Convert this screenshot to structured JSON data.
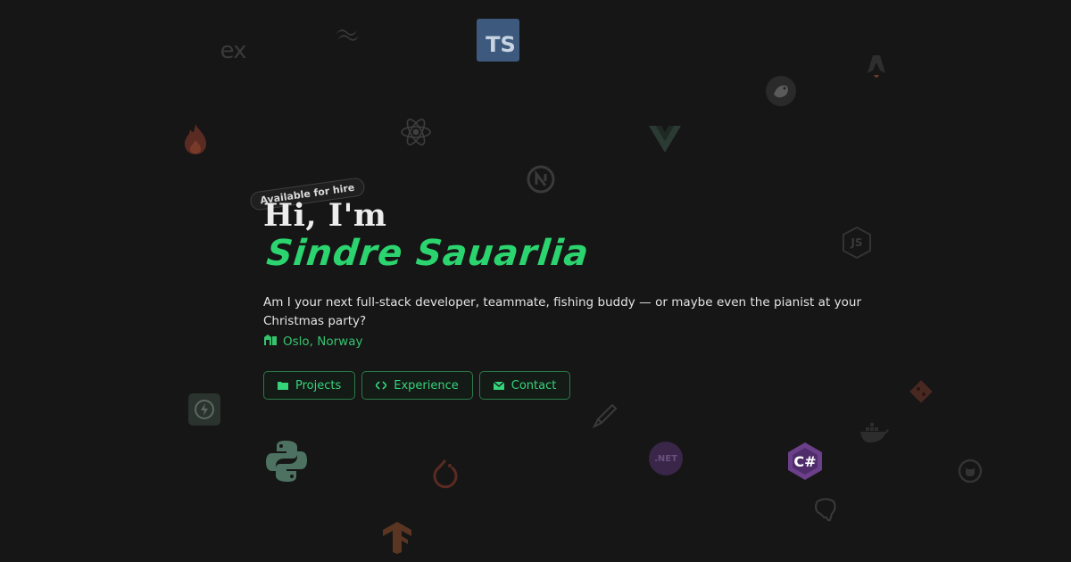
{
  "badge": "Available for hire",
  "greeting": "Hi, I'm",
  "name": "Sindre Sauarlia",
  "intro": "Am I your next full-stack developer, teammate, fishing buddy — or maybe even the pianist at your Christmas party?",
  "location": "Oslo, Norway",
  "buttons": {
    "projects": "Projects",
    "experience": "Experience",
    "contact": "Contact"
  },
  "icons": {
    "express": "ex",
    "typescript": "TS",
    "csharp": "C#",
    "dotnet": ".NET",
    "nodejs": "JS"
  },
  "colors": {
    "background": "#161616",
    "accent": "#2bd46f",
    "button_border": "#2a7a4a",
    "text": "#e6e6e6"
  }
}
